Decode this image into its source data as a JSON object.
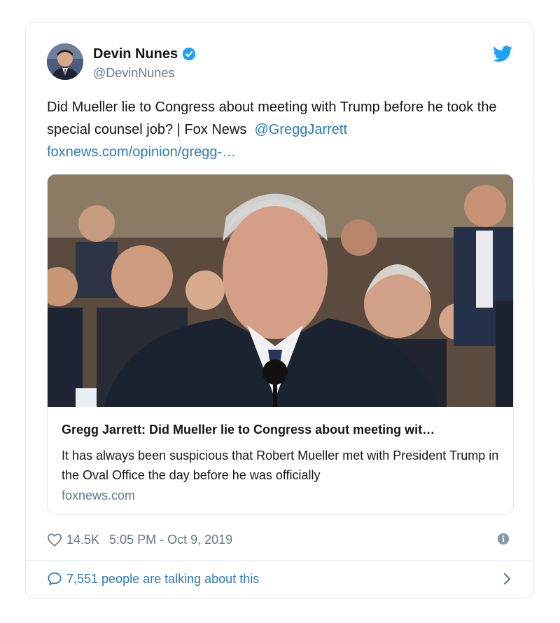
{
  "tweet": {
    "author_name": "Devin Nunes",
    "author_handle": "@DevinNunes",
    "text_main": "Did Mueller lie to Congress about meeting with Trump before he took the special counsel job? | Fox News",
    "mention": "@GreggJarrett",
    "url_text": "foxnews.com/opinion/gregg-…",
    "link_card": {
      "title": "Gregg Jarrett: Did Mueller lie to Congress about meeting wit…",
      "description": "It has always been suspicious that Robert Mueller met with President Trump in the Oval Office the day before he was officially",
      "domain": "foxnews.com"
    },
    "likes": "14.5K",
    "timestamp": "5:05 PM - Oct 9, 2019",
    "talking": "7,551 people are talking about this"
  },
  "icons": {
    "verified": "verified-badge-icon",
    "bird": "twitter-bird-icon",
    "heart": "heart-icon",
    "info": "info-icon",
    "bubble": "speech-bubble-icon",
    "chevron": "chevron-right-icon"
  },
  "colors": {
    "link": "#2b7bb9",
    "verified": "#1da1f2",
    "secondary_text": "#657786",
    "border": "#e1e8ed"
  }
}
